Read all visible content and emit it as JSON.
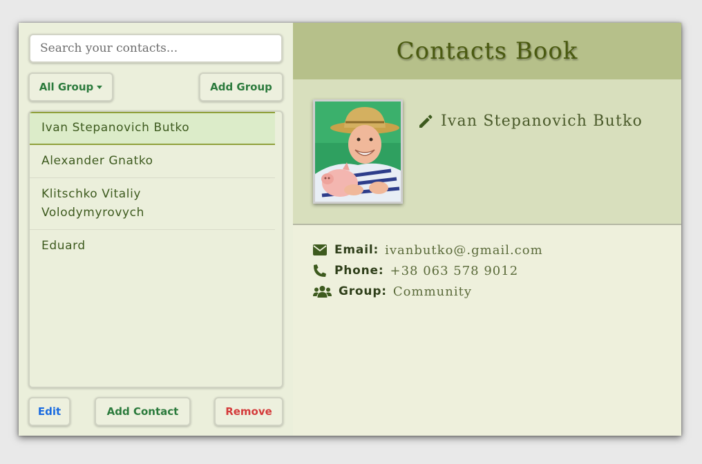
{
  "search": {
    "placeholder": "Search your contacts..."
  },
  "group_filter": {
    "selected": "All Group"
  },
  "buttons": {
    "add_group": "Add Group",
    "edit": "Edit",
    "add_contact": "Add Contact",
    "remove": "Remove"
  },
  "contacts": [
    {
      "name": "Ivan Stepanovich Butko",
      "active": true
    },
    {
      "name": "Alexander Gnatko",
      "active": false
    },
    {
      "name": "Klitschko Vitaliy Volodymyrovych",
      "active": false
    },
    {
      "name": "Eduard",
      "active": false
    }
  ],
  "header": {
    "title": "Contacts Book"
  },
  "selected_contact": {
    "name": "Ivan Stepanovich Butko",
    "email_label": "Email:",
    "email": "ivanbutko@.gmail.com",
    "phone_label": "Phone:",
    "phone": "+38 063 578 9012",
    "group_label": "Group:",
    "group": "Community"
  },
  "colors": {
    "accent_green": "#2b7a3c",
    "edit_blue": "#1a6be0",
    "remove_red": "#d43b3b",
    "header_bg": "#b6c08a",
    "active_item_bg": "#dcecc9"
  },
  "icons": {
    "edit": "pencil-icon",
    "email": "envelope-icon",
    "phone": "phone-icon",
    "group": "users-icon",
    "dropdown": "caret-down-icon"
  }
}
